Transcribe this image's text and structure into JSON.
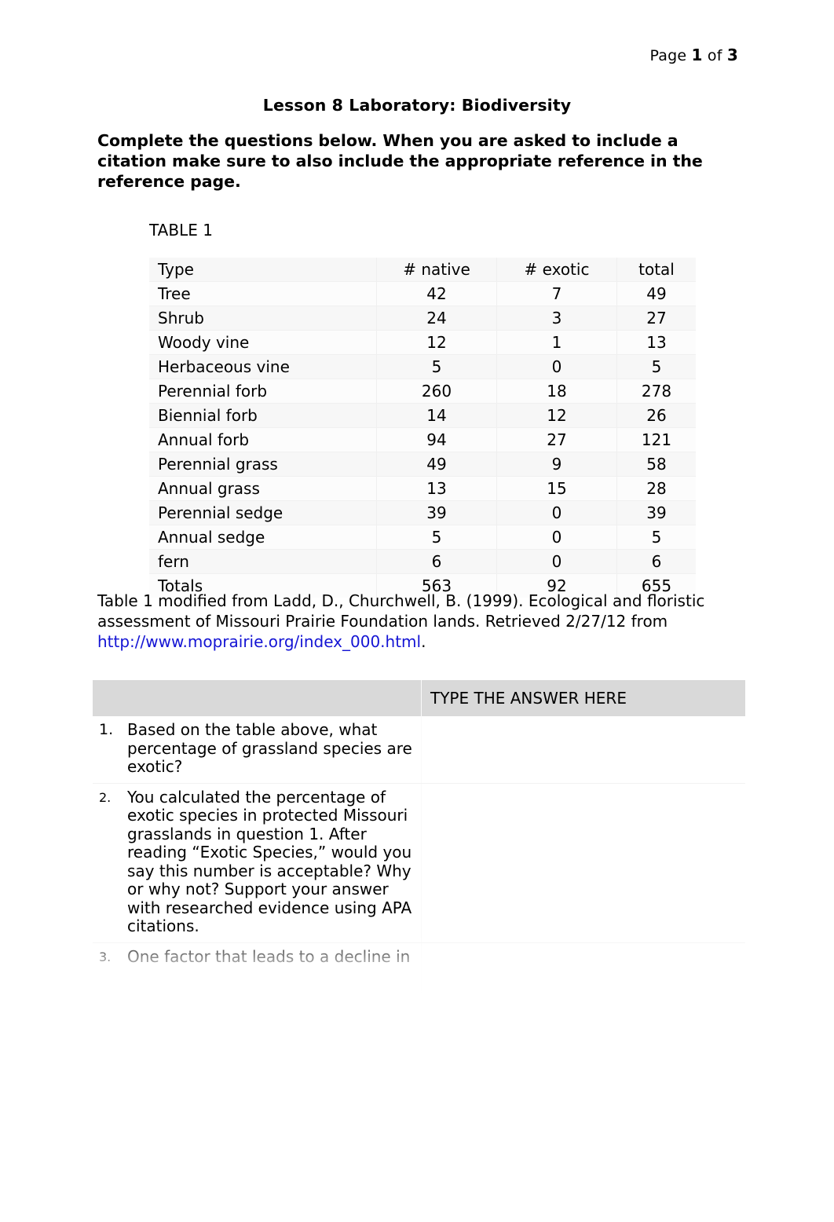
{
  "header": {
    "prefix": "Page ",
    "current_page": "1",
    "middle": " of ",
    "total_pages": "3"
  },
  "document": {
    "title": "Lesson 8 Laboratory: Biodiversity",
    "instructions": "Complete the questions below. When you are asked to include a citation make sure to also include the appropriate reference in the reference page."
  },
  "table1": {
    "label": "TABLE 1",
    "columns": [
      "Type",
      "# native",
      "# exotic",
      "total"
    ],
    "rows": [
      {
        "type": "Tree",
        "native": "42",
        "exotic": "7",
        "total": "49"
      },
      {
        "type": "Shrub",
        "native": "24",
        "exotic": "3",
        "total": "27"
      },
      {
        "type": "Woody vine",
        "native": "12",
        "exotic": "1",
        "total": "13"
      },
      {
        "type": "Herbaceous vine",
        "native": "5",
        "exotic": "0",
        "total": "5"
      },
      {
        "type": "Perennial forb",
        "native": "260",
        "exotic": "18",
        "total": "278"
      },
      {
        "type": "Biennial forb",
        "native": "14",
        "exotic": "12",
        "total": "26"
      },
      {
        "type": "Annual forb",
        "native": "94",
        "exotic": "27",
        "total": "121"
      },
      {
        "type": "Perennial grass",
        "native": "49",
        "exotic": "9",
        "total": "58"
      },
      {
        "type": "Annual grass",
        "native": "13",
        "exotic": "15",
        "total": "28"
      },
      {
        "type": "Perennial sedge",
        "native": "39",
        "exotic": "0",
        "total": "39"
      },
      {
        "type": "Annual sedge",
        "native": "5",
        "exotic": "0",
        "total": "5"
      },
      {
        "type": "fern",
        "native": "6",
        "exotic": "0",
        "total": "6"
      },
      {
        "type": "Totals",
        "native": "563",
        "exotic": "92",
        "total": "655"
      }
    ],
    "caption_before_link": "Table 1 modified from Ladd, D., Churchwell, B. (1999). Ecological and floristic assessment of Missouri Prairie Foundation lands. Retrieved 2/27/12 from ",
    "caption_link": "http://www.moprairie.org/index_000.html",
    "caption_after_link": "."
  },
  "question_table": {
    "answer_column_header": "TYPE THE ANSWER HERE",
    "questions": [
      {
        "number": "1.",
        "text": "Based on the table above, what percentage of grassland species are exotic?",
        "answer": ""
      },
      {
        "number": "2.",
        "text": "You calculated the percentage of exotic species in protected Missouri grasslands in question 1.  After reading “Exotic Species,” would you say this number is acceptable?  Why or why not? Support your answer with researched evidence using APA citations.",
        "answer": ""
      },
      {
        "number": "3.",
        "text": "One factor that leads to a decline in",
        "answer": ""
      }
    ]
  },
  "colors": {
    "link": "#1414d4",
    "header_row_fill": "#d9d9d9",
    "table_stripe": "#f7f7f7"
  }
}
